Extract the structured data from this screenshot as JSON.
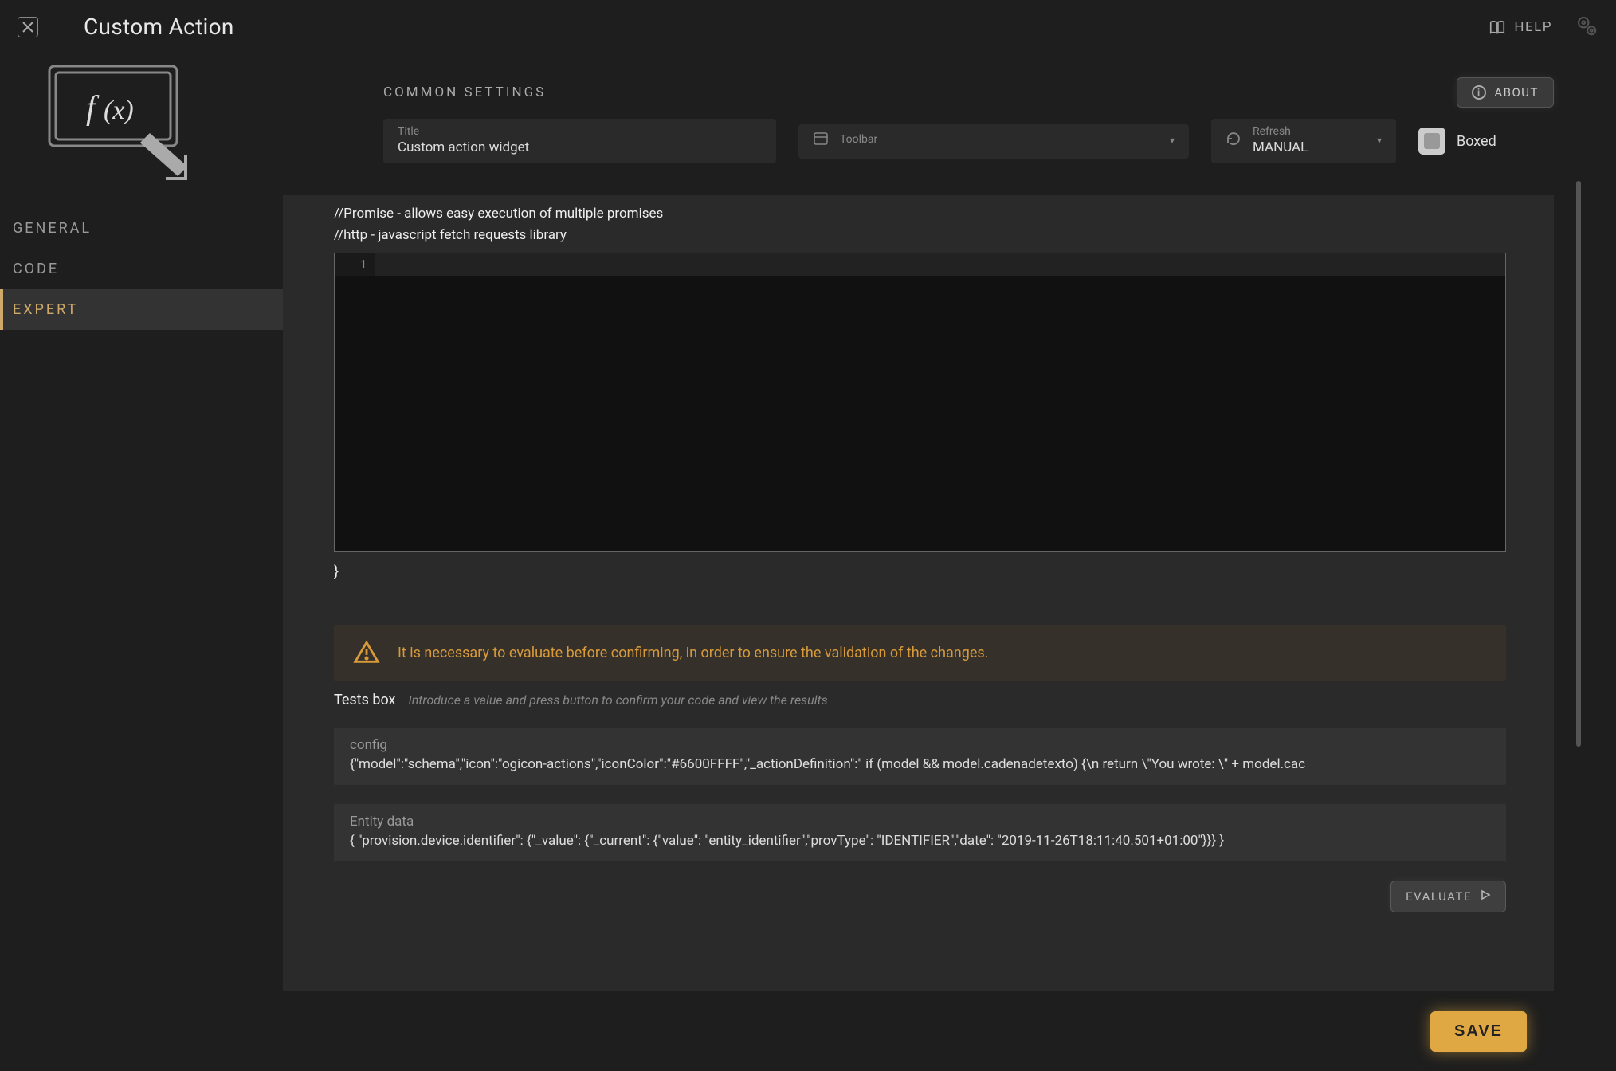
{
  "header": {
    "title": "Custom Action",
    "help_label": "HELP"
  },
  "nav": {
    "items": [
      "GENERAL",
      "CODE",
      "EXPERT"
    ],
    "active_index": 2
  },
  "settings": {
    "section_label": "COMMON SETTINGS",
    "about_label": "ABOUT",
    "title_label": "Title",
    "title_value": "Custom action widget",
    "toolbar_label": "Toolbar",
    "toolbar_value": "",
    "refresh_label": "Refresh",
    "refresh_value": "MANUAL",
    "boxed_label": "Boxed"
  },
  "editor": {
    "comment_line1": "//Promise - allows easy execution of multiple promises",
    "comment_line2": "//http - javascript fetch requests library",
    "gutter_line": "1",
    "closing": "}"
  },
  "warning": {
    "text": "It is necessary to evaluate before confirming, in order to ensure the validation of the changes."
  },
  "tests": {
    "label": "Tests box",
    "hint": "Introduce a value and press button to confirm your code and view the results"
  },
  "config_box": {
    "label": "config",
    "value": "{\"model\":\"schema\",\"icon\":\"ogicon-actions\",\"iconColor\":\"#6600FFFF\",\"_actionDefinition\":\"  if (model && model.cadenadetexto) {\\n    return \\\"You wrote: \\\" + model.cac"
  },
  "entity_box": {
    "label": "Entity data",
    "value": "{ \"provision.device.identifier\": {\"_value\": {\"_current\": {\"value\": \"entity_identifier\",\"provType\": \"IDENTIFIER\",\"date\": \"2019-11-26T18:11:40.501+01:00\"}}} }"
  },
  "buttons": {
    "evaluate": "EVALUATE",
    "save": "SAVE"
  },
  "colors": {
    "accent": "#cfa96a",
    "warning": "#d99a3a",
    "save_bg": "#e0a842"
  }
}
